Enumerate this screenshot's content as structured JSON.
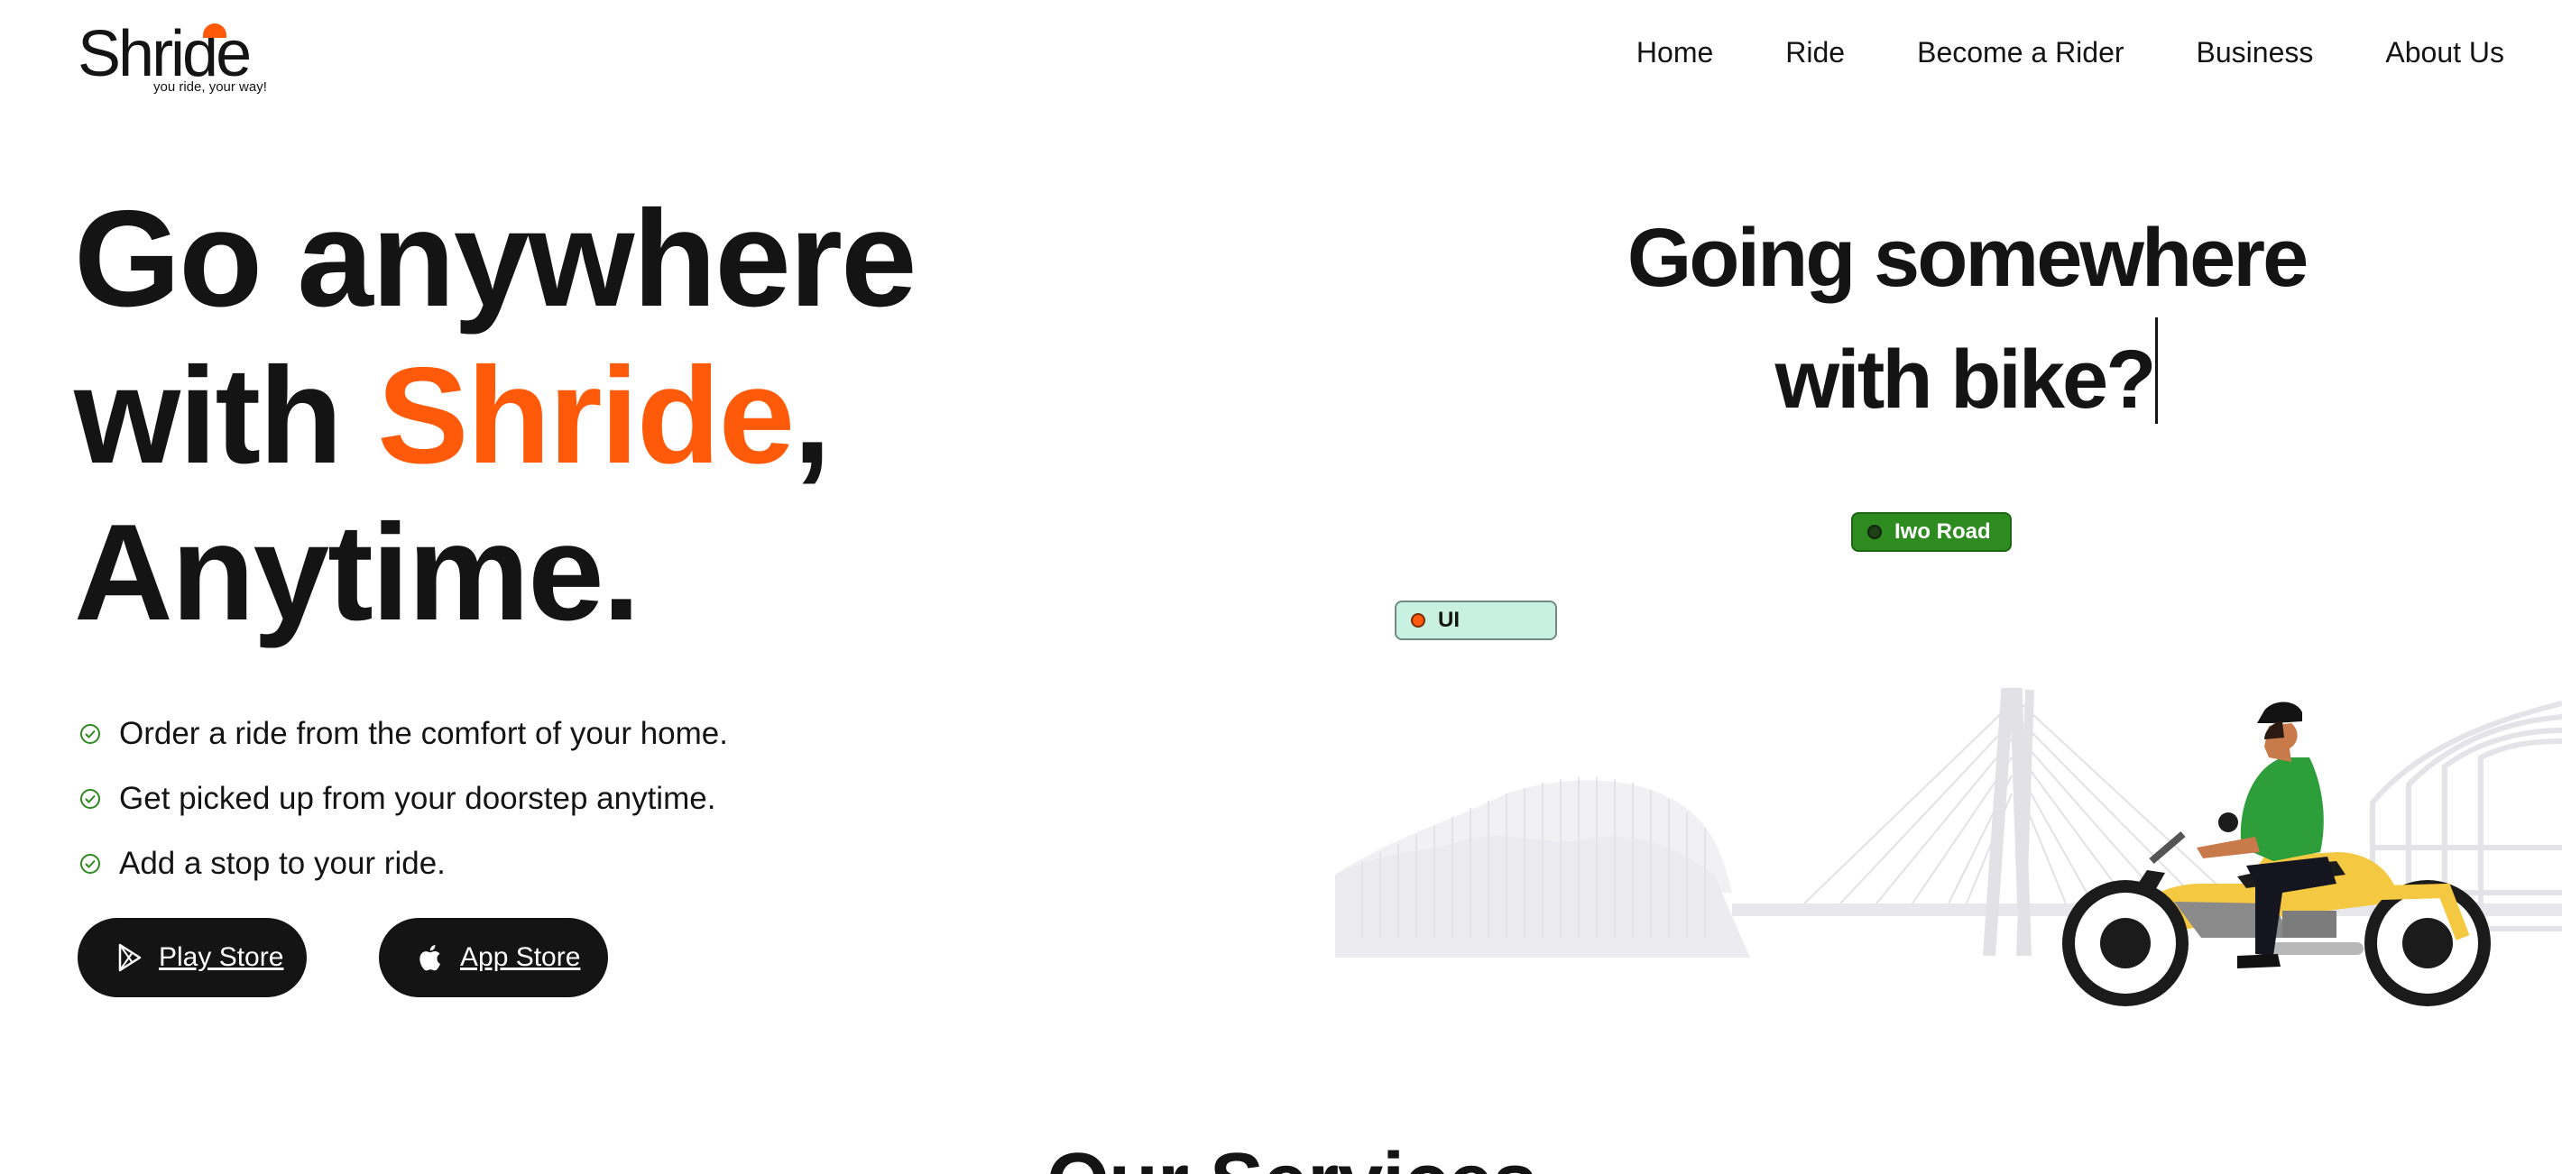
{
  "brand": {
    "name": "Shride",
    "tagline": "you ride, your way!",
    "accent_color": "#ff5a0a"
  },
  "nav": {
    "items": [
      {
        "label": "Home"
      },
      {
        "label": "Ride"
      },
      {
        "label": "Become a Rider"
      },
      {
        "label": "Business"
      },
      {
        "label": "About Us"
      }
    ]
  },
  "hero": {
    "title_line1": "Go anywhere",
    "title_line2_prefix": "with ",
    "title_line2_accent": "Shride",
    "title_line2_suffix": ",",
    "title_line3": "Anytime.",
    "features": [
      {
        "text": "Order a ride from the comfort of your home.",
        "icon": "check-circle-icon"
      },
      {
        "text": "Get picked up from your doorstep anytime.",
        "icon": "check-circle-icon"
      },
      {
        "text": "Add a stop to your ride.",
        "icon": "check-circle-icon"
      }
    ],
    "check_color": "#2e8b1f",
    "buttons": {
      "play_store": {
        "label": "Play Store",
        "icon": "play-store-icon"
      },
      "app_store": {
        "label": "App Store",
        "icon": "apple-icon"
      }
    }
  },
  "illustration": {
    "heading_line1": "Going somewhere",
    "heading_line2": "with bike?",
    "location_pills": [
      {
        "label": "Iwo Road",
        "color": "#2e8b1f"
      },
      {
        "label": "UI",
        "color": "#c8f1e2"
      }
    ],
    "rider_shirt_color": "#2e9e3a",
    "bike_color": "#f5c842"
  },
  "next_section": {
    "title": "Our Services"
  }
}
